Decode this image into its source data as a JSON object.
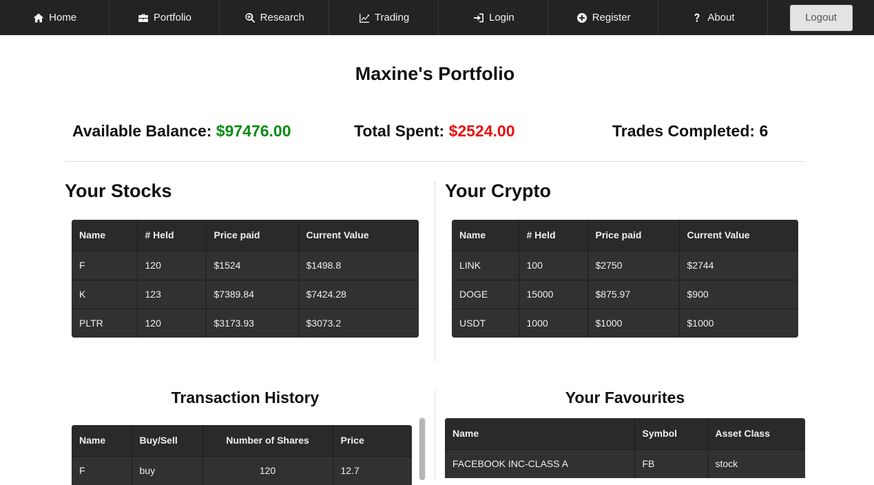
{
  "nav": {
    "items": [
      {
        "label": "Home",
        "icon": "home-icon"
      },
      {
        "label": "Portfolio",
        "icon": "briefcase-icon"
      },
      {
        "label": "Research",
        "icon": "search-plus-icon"
      },
      {
        "label": "Trading",
        "icon": "line-chart-icon"
      },
      {
        "label": "Login",
        "icon": "login-icon"
      },
      {
        "label": "Register",
        "icon": "plus-circle-icon"
      },
      {
        "label": "About",
        "icon": "question-icon"
      }
    ],
    "logout_label": "Logout"
  },
  "header": {
    "title": "Maxine's Portfolio",
    "balance_label": "Available Balance: ",
    "balance_value": "$97476.00",
    "spent_label": "Total Spent: ",
    "spent_value": "$2524.00",
    "trades_label": "Trades Completed: ",
    "trades_value": "6"
  },
  "colors": {
    "positive": "#0a8a12",
    "negative": "#ec1010",
    "navbar_bg": "#232323",
    "table_bg": "#2b2b2b"
  },
  "stocks": {
    "title": "Your Stocks",
    "columns": [
      "Name",
      "# Held",
      "Price paid",
      "Current Value"
    ],
    "rows": [
      [
        "F",
        "120",
        "$1524",
        "$1498.8"
      ],
      [
        "K",
        "123",
        "$7389.84",
        "$7424.28"
      ],
      [
        "PLTR",
        "120",
        "$3173.93",
        "$3073.2"
      ]
    ]
  },
  "crypto": {
    "title": "Your Crypto",
    "columns": [
      "Name",
      "# Held",
      "Price paid",
      "Current Value"
    ],
    "rows": [
      [
        "LINK",
        "100",
        "$2750",
        "$2744"
      ],
      [
        "DOGE",
        "15000",
        "$875.97",
        "$900"
      ],
      [
        "USDT",
        "1000",
        "$1000",
        "$1000"
      ]
    ]
  },
  "transactions": {
    "title": "Transaction History",
    "columns": [
      "Name",
      "Buy/Sell",
      "Number of Shares",
      "Price"
    ],
    "rows": [
      [
        "F",
        "buy",
        "120",
        "12.7"
      ]
    ]
  },
  "favourites": {
    "title": "Your Favourites",
    "columns": [
      "Name",
      "Symbol",
      "Asset Class"
    ],
    "rows": [
      [
        "FACEBOOK INC-CLASS A",
        "FB",
        "stock"
      ]
    ]
  }
}
